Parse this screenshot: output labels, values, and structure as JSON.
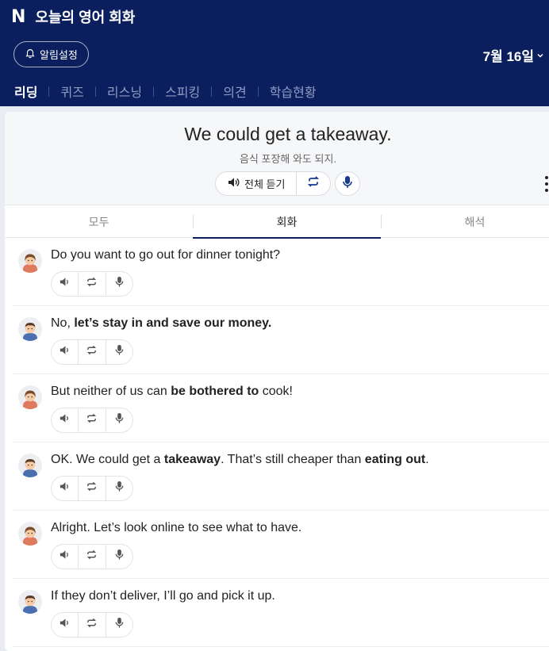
{
  "app": {
    "logo": "N",
    "title": "오늘의 영어 회화"
  },
  "header": {
    "alarm_label": "알림설정",
    "date": "7월 16일"
  },
  "nav": [
    "리딩",
    "퀴즈",
    "리스닝",
    "스피킹",
    "의견",
    "학습현황"
  ],
  "nav_active": 0,
  "hero": {
    "sentence": "We could get a takeaway.",
    "translation": "음식 포장해 와도 되지.",
    "listen_all": "전체 듣기"
  },
  "tabs": [
    "모두",
    "회화",
    "해석"
  ],
  "tab_active": 1,
  "lines": [
    {
      "speaker": "female",
      "segments": [
        {
          "t": "Do you want to go out for dinner tonight?",
          "b": false
        }
      ]
    },
    {
      "speaker": "male",
      "segments": [
        {
          "t": "No, ",
          "b": false
        },
        {
          "t": "let’s stay in and save our money.",
          "b": true
        }
      ]
    },
    {
      "speaker": "female",
      "segments": [
        {
          "t": "But neither of us can ",
          "b": false
        },
        {
          "t": "be bothered to",
          "b": true
        },
        {
          "t": " cook!",
          "b": false
        }
      ]
    },
    {
      "speaker": "male",
      "segments": [
        {
          "t": "OK. We could get a ",
          "b": false
        },
        {
          "t": "takeaway",
          "b": true
        },
        {
          "t": ". That’s still cheaper than ",
          "b": false
        },
        {
          "t": "eating out",
          "b": true
        },
        {
          "t": ".",
          "b": false
        }
      ]
    },
    {
      "speaker": "female",
      "segments": [
        {
          "t": "Alright. Let’s look online to see what to have.",
          "b": false
        }
      ]
    },
    {
      "speaker": "male",
      "segments": [
        {
          "t": "If they don’t deliver, I’ll go and pick it up.",
          "b": false
        }
      ]
    }
  ],
  "colors": {
    "header_bg": "#0b1f5e",
    "nav_inactive": "#8f9bc2",
    "tab_underline": "#0b1f5e"
  },
  "icons": {
    "alarm": "bell-icon",
    "date": "chevron-down-icon",
    "listen": "speaker-icon",
    "repeat": "repeat-icon",
    "mic": "mic-icon",
    "more": "kebab-icon"
  }
}
